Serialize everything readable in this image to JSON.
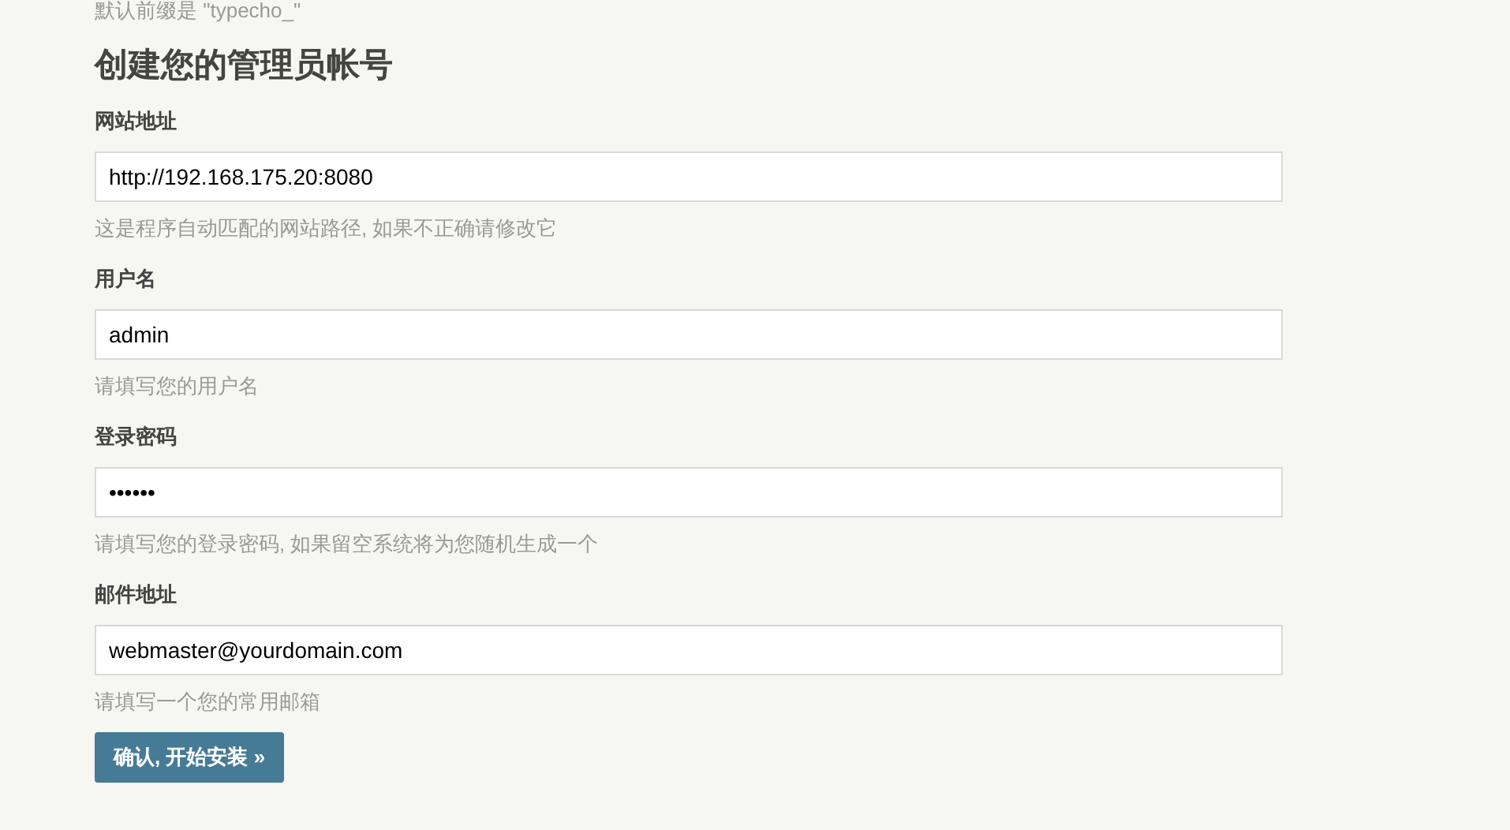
{
  "top_note": "默认前缀是 \"typecho_\"",
  "heading": "创建您的管理员帐号",
  "fields": [
    {
      "label": "网站地址",
      "value": "http://192.168.175.20:8080",
      "hint": "这是程序自动匹配的网站路径, 如果不正确请修改它"
    },
    {
      "label": "用户名",
      "value": "admin",
      "hint": "请填写您的用户名"
    },
    {
      "label": "登录密码",
      "value": "••••••",
      "hint": "请填写您的登录密码, 如果留空系统将为您随机生成一个"
    },
    {
      "label": "邮件地址",
      "value": "webmaster@yourdomain.com",
      "hint": "请填写一个您的常用邮箱"
    }
  ],
  "submit_button": "确认, 开始安装 »"
}
